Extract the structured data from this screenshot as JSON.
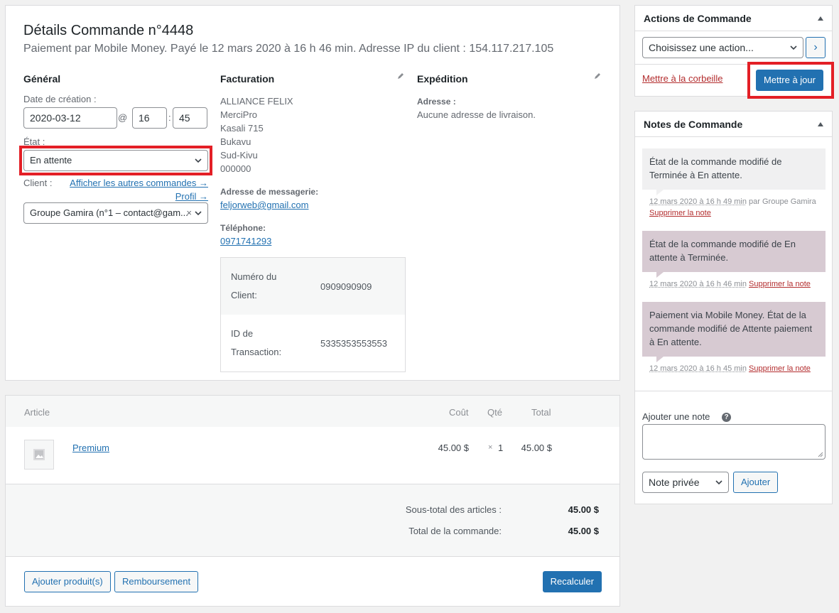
{
  "details": {
    "title": "Détails Commande n°4448",
    "subtitle": "Paiement par Mobile Money. Payé le 12 mars 2020 à 16 h 46 min. Adresse IP du client : 154.117.217.105",
    "general": {
      "heading": "Général",
      "date_label": "Date de création :",
      "date_value": "2020-03-12",
      "at": "@",
      "hour": "16",
      "colon": ":",
      "minute": "45",
      "status_label": "État :",
      "status_value": "En attente",
      "client_label": "Client :",
      "other_orders_link": "Afficher les autres commandes →",
      "profile_link": "Profil →",
      "client_value": "Groupe Gamira (n°1 – contact@gam...",
      "client_clear": "×"
    },
    "billing": {
      "heading": "Facturation",
      "address_lines": [
        "ALLIANCE FELIX",
        "MerciPro",
        "Kasali 715",
        "Bukavu",
        "Sud-Kivu",
        "000000"
      ],
      "email_label": "Adresse de messagerie:",
      "email": "feljorweb@gmail.com",
      "phone_label": "Téléphone:",
      "phone": "0971741293",
      "meta": [
        {
          "key_line1": "Numéro du",
          "key_line2": "Client:",
          "value": "0909090909"
        },
        {
          "key_line1": "ID de",
          "key_line2": "Transaction:",
          "value": "5335353553553"
        }
      ]
    },
    "shipping": {
      "heading": "Expédition",
      "address_label": "Adresse :",
      "address_value": "Aucune adresse de livraison."
    }
  },
  "items": {
    "headers": {
      "article": "Article",
      "cost": "Coût",
      "qty": "Qté",
      "total": "Total"
    },
    "rows": [
      {
        "name": "Premium",
        "cost": "45.00 $",
        "qty_prefix": "×",
        "qty": "1",
        "total": "45.00 $"
      }
    ],
    "subtotal_label": "Sous-total des articles :",
    "subtotal_value": "45.00 $",
    "order_total_label": "Total de la commande:",
    "order_total_value": "45.00 $",
    "add_products_button": "Ajouter produit(s)",
    "refund_button": "Remboursement",
    "recalculate_button": "Recalculer"
  },
  "actions": {
    "title": "Actions de Commande",
    "select_value": "Choisissez une action...",
    "go_button": "›",
    "trash_link": "Mettre à la corbeille",
    "update_button": "Mettre à jour"
  },
  "notes": {
    "title": "Notes de Commande",
    "list": [
      {
        "text": "État de la commande modifié de Terminée à En attente.",
        "date": "12 mars 2020 à 16 h 49 min",
        "by": " par Groupe Gamira",
        "delete": "Supprimer la note",
        "style": "gray"
      },
      {
        "text": "État de la commande modifié de En attente à Terminée.",
        "date": "12 mars 2020 à 16 h 46 min",
        "by": "",
        "delete": "Supprimer la note",
        "style": "purple"
      },
      {
        "text": "Paiement via Mobile Money. État de la commande modifié de Attente paiement à En attente.",
        "date": "12 mars 2020 à 16 h 45 min",
        "by": "",
        "delete": "Supprimer la note",
        "style": "purple"
      }
    ],
    "add_note_label": "Ajouter une note",
    "help_icon": "?",
    "note_type_value": "Note privée",
    "add_button": "Ajouter"
  },
  "colors": {
    "accent": "#2271b1",
    "highlight": "#e31f26",
    "note_customer": "#d7cad2",
    "note_private": "#f0f0f1",
    "delete_link": "#b32d2e"
  }
}
